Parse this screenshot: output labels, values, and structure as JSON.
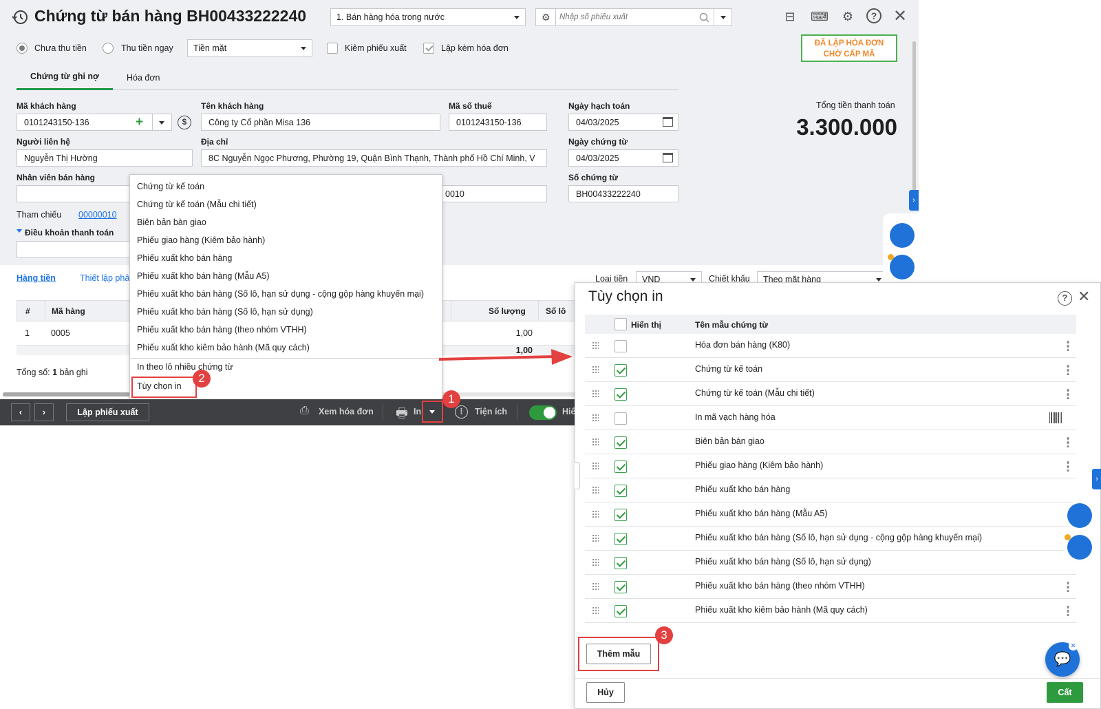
{
  "window": {
    "title": "Chứng từ bán hàng BH00433222240",
    "type_select": "1. Bán hàng hóa trong nước",
    "search_placeholder": "Nhập số phiếu xuất"
  },
  "options": {
    "radio_unpaid": "Chưa thu tiền",
    "radio_paid": "Thu tiền ngay",
    "payment_method": "Tiền mặt",
    "chk_export": "Kiêm phiếu xuất",
    "chk_invoice": "Lập kèm hóa đơn"
  },
  "stamp": {
    "line1": "ĐÃ LẬP HÓA ĐƠN",
    "line2": "CHỜ CẤP MÃ"
  },
  "tabs": {
    "debit": "Chứng từ ghi nợ",
    "invoice": "Hóa đơn"
  },
  "form": {
    "customer_code_label": "Mã khách hàng",
    "customer_code": "0101243150-136",
    "customer_name_label": "Tên khách hàng",
    "customer_name": "Công ty Cổ phần Misa 136",
    "tax_code_label": "Mã số thuế",
    "tax_code": "0101243150-136",
    "contact_label": "Người liên hệ",
    "contact": "Nguyễn Thị Hường",
    "address_label": "Địa chỉ",
    "address": "8C Nguyễn Ngọc Phương, Phường 19, Quận Bình Thạnh, Thành phố Hồ Chí Minh, V",
    "salesperson_label": "Nhân viên bán hàng",
    "hidden_value": "0010",
    "reference_label": "Tham chiếu",
    "reference": "00000010",
    "payment_terms_label": "Điều khoản thanh toán",
    "posting_date_label": "Ngày hạch toán",
    "posting_date": "04/03/2025",
    "doc_date_label": "Ngày chứng từ",
    "doc_date": "04/03/2025",
    "doc_no_label": "Số chứng từ",
    "doc_no": "BH00433222240",
    "total_label": "Tổng tiền thanh toán",
    "total": "3.300.000"
  },
  "grid": {
    "tab_goods": "Hàng tiền",
    "tab_setup": "Thiết lập phâ",
    "currency_label": "Loại tiền",
    "currency": "VND",
    "discount_label": "Chiết khấu",
    "discount": "Theo mặt hàng",
    "col_num": "#",
    "col_code": "Mã hàng",
    "col_qty": "Số lượng",
    "col_lot": "Số lô",
    "row1_num": "1",
    "row1_code": "0005",
    "row1_qty": "1,00",
    "sum_qty": "1,00",
    "total_records_prefix": "Tổng số:",
    "total_records_count": "1",
    "total_records_suffix": "bản ghi"
  },
  "print_menu": {
    "items": [
      "Chứng từ kế toán",
      "Chứng từ kế toán (Mẫu chi tiết)",
      "Biên bản bàn giao",
      "Phiếu giao hàng (Kiêm bảo hành)",
      "Phiếu xuất kho bán hàng",
      "Phiếu xuất kho bán hàng (Mẫu A5)",
      "Phiếu xuất kho bán hàng (Số lô, hạn sử dụng - cộng gộp hàng khuyến mại)",
      "Phiếu xuất kho bán hàng (Số lô, hạn sử dụng)",
      "Phiếu xuất kho bán hàng (theo nhóm VTHH)",
      "Phiếu xuất kho kiêm bảo hành (Mã quy cách)"
    ],
    "batch_print": "In theo lô nhiều chứng từ",
    "print_options": "Tùy chọn in"
  },
  "toolbar": {
    "create_export": "Lập phiếu xuất",
    "view_invoice": "Xem hóa đơn",
    "print": "In",
    "utilities": "Tiện ích",
    "toggle_label": "Hiể"
  },
  "steps": {
    "s1": "1",
    "s2": "2",
    "s3": "3"
  },
  "dialog": {
    "title": "Tùy chọn in",
    "col_show": "Hiển thị",
    "col_name": "Tên mẫu chứng từ",
    "rows": [
      {
        "name": "Hóa đơn bán hàng (K80)",
        "checked": false
      },
      {
        "name": "Chứng từ kế toán",
        "checked": true
      },
      {
        "name": "Chứng từ kế toán (Mẫu chi tiết)",
        "checked": true
      },
      {
        "name": "In mã vạch hàng hóa",
        "checked": false
      },
      {
        "name": "Biên bản bàn giao",
        "checked": true
      },
      {
        "name": "Phiếu giao hàng (Kiêm bảo hành)",
        "checked": true
      },
      {
        "name": "Phiếu xuất kho bán hàng",
        "checked": true
      },
      {
        "name": "Phiếu xuất kho bán hàng (Mẫu A5)",
        "checked": true
      },
      {
        "name": "Phiếu xuất kho bán hàng (Số lô, hạn sử dụng - cộng gộp hàng khuyến mại)",
        "checked": true
      },
      {
        "name": "Phiếu xuất kho bán hàng (Số lô, hạn sử dụng)",
        "checked": true
      },
      {
        "name": "Phiếu xuất kho bán hàng (theo nhóm VTHH)",
        "checked": true
      },
      {
        "name": "Phiếu xuất kho kiêm bảo hành (Mã quy cách)",
        "checked": true
      }
    ],
    "add_template": "Thêm mẫu",
    "cancel": "Hủy",
    "save": "Cất"
  },
  "colors": {
    "accent_blue": "#1f73d8",
    "green": "#2e9a3e",
    "red": "#e34040",
    "toolbar": "#3e4044"
  }
}
